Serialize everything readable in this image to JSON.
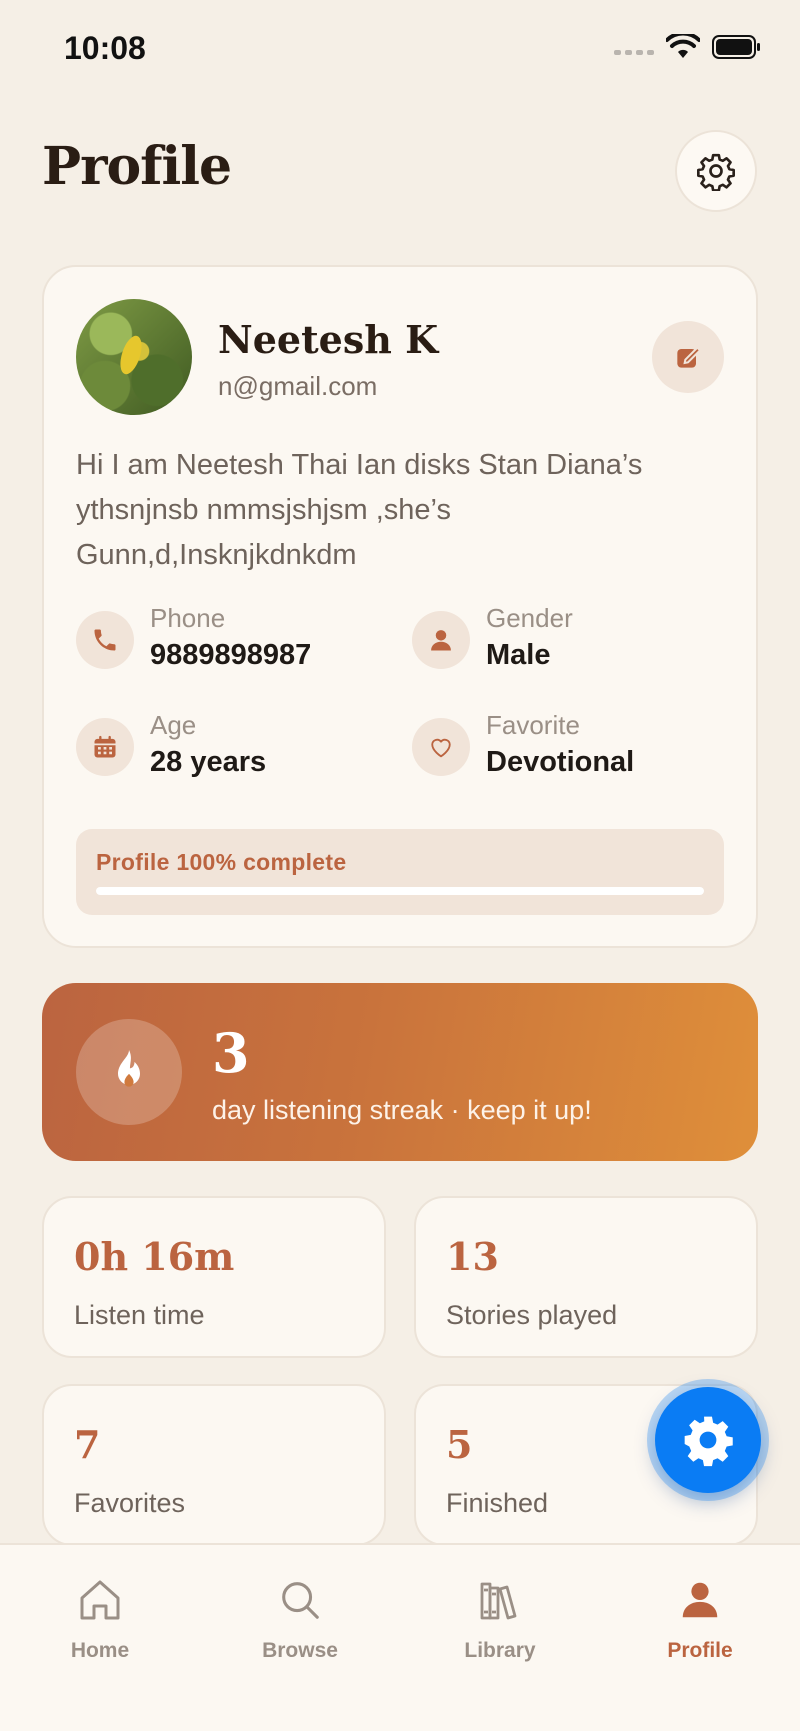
{
  "status": {
    "time": "10:08"
  },
  "header": {
    "title": "Profile"
  },
  "profile": {
    "name": "Neetesh K",
    "email": "n@gmail.com",
    "bio": "Hi I am Neetesh Thai Ian disks Stan Diana’s ythsnjnsb nmmsjshjsm ,she’s Gunn,d,Insknjkdnkdm",
    "details": [
      {
        "label": "Phone",
        "value": "9889898987",
        "icon": "phone-icon"
      },
      {
        "label": "Gender",
        "value": "Male",
        "icon": "person-icon"
      },
      {
        "label": "Age",
        "value": "28 years",
        "icon": "calendar-icon"
      },
      {
        "label": "Favorite",
        "value": "Devotional",
        "icon": "heart-icon"
      }
    ],
    "completion_label": "Profile 100% complete",
    "completion_fraction": 1.0
  },
  "streak": {
    "count": "3",
    "text": "day listening streak · keep it up!",
    "icon": "flame-icon"
  },
  "stats": [
    {
      "value": "0h 16m",
      "label": "Listen time"
    },
    {
      "value": "13",
      "label": "Stories played"
    },
    {
      "value": "7",
      "label": "Favorites"
    },
    {
      "value": "5",
      "label": "Finished"
    }
  ],
  "nav": [
    {
      "label": "Home",
      "icon": "home-icon",
      "active": false
    },
    {
      "label": "Browse",
      "icon": "search-icon",
      "active": false
    },
    {
      "label": "Library",
      "icon": "library-icon",
      "active": false
    },
    {
      "label": "Profile",
      "icon": "person-icon",
      "active": true
    }
  ],
  "colors": {
    "background": "#f5efe6",
    "accent": "#bb6440",
    "streak_gradient_start": "#bb6440",
    "streak_gradient_end": "#df8f3a",
    "fab": "#0a7cf4"
  }
}
